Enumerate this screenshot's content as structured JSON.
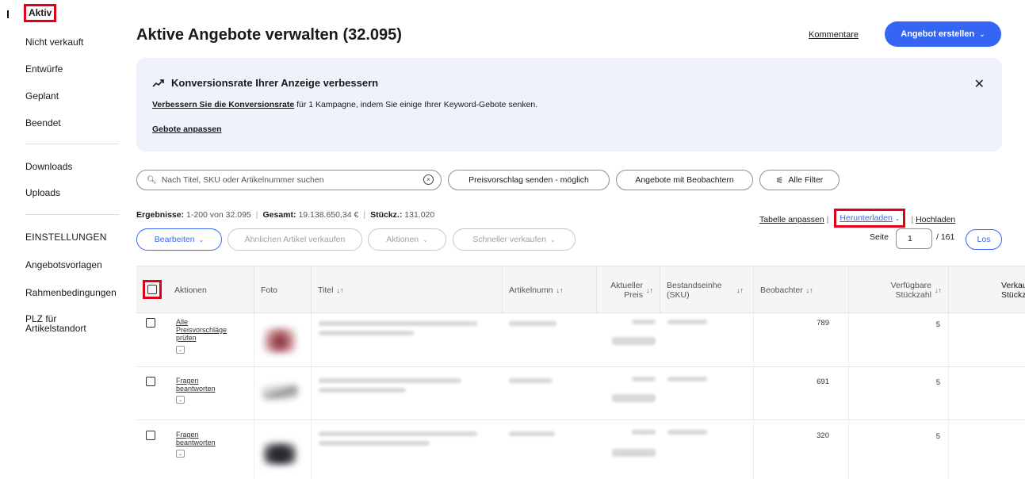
{
  "sidebar": {
    "items": [
      {
        "label": "Aktiv"
      },
      {
        "label": "Nicht verkauft"
      },
      {
        "label": "Entwürfe"
      },
      {
        "label": "Geplant"
      },
      {
        "label": "Beendet"
      },
      {
        "label": "Downloads"
      },
      {
        "label": "Uploads"
      }
    ],
    "settings_heading": "EINSTELLUNGEN",
    "settings_items": [
      {
        "label": "Angebotsvorlagen"
      },
      {
        "label": "Rahmenbedingungen"
      },
      {
        "label": "PLZ für"
      },
      {
        "label": "Artikelstandort"
      }
    ]
  },
  "header": {
    "title": "Aktive Angebote verwalten (32.095)",
    "comments_link": "Kommentare",
    "create_button": "Angebot erstellen"
  },
  "banner": {
    "title": "Konversionsrate Ihrer Anzeige verbessern",
    "text_link": "Verbessern Sie die Konversionsrate",
    "text_rest": " für 1 Kampagne, indem Sie einige Ihrer Keyword-Gebote senken.",
    "action_link": "Gebote anpassen",
    "close": "✕"
  },
  "search": {
    "placeholder": "Nach Titel, SKU oder Artikelnummer suchen"
  },
  "filters": {
    "offer": "Preisvorschlag senden - möglich",
    "watchers": "Angebote mit Beobachtern",
    "all": "Alle Filter"
  },
  "results": {
    "label": "Ergebnisse:",
    "range": "1-200 von 32.095",
    "total_label": "Gesamt:",
    "total": "19.138.650,34 €",
    "pieces_label": "Stückz.:",
    "pieces": "131.020"
  },
  "links": {
    "customize": "Tabelle anpassen",
    "download": "Herunterladen",
    "upload": "Hochladen"
  },
  "actions": {
    "edit": "Bearbeiten",
    "sell_similar": "Ähnlichen Artikel verkaufen",
    "actions": "Aktionen",
    "quick_sell": "Schneller verkaufen"
  },
  "pagination": {
    "label": "Seite",
    "current": "1",
    "total": "/ 161",
    "go": "Los"
  },
  "table": {
    "headers": {
      "actions": "Aktionen",
      "photo": "Foto",
      "title": "Titel",
      "item_number": "Artikelnumn",
      "price_1": "Aktueller",
      "price_2": "Preis",
      "sku_1": "Bestandseinhe",
      "sku_2": "(SKU)",
      "watchers": "Beobachter",
      "available_1": "Verfügbare",
      "available_2": "Stückzahl",
      "sold_1": "Verkau",
      "sold_2": "Stückz"
    },
    "rows": [
      {
        "action_1": "Alle",
        "action_2": "Preisvorschläge",
        "action_3": "prüfen",
        "watchers": "789",
        "available": "5"
      },
      {
        "action_1": "Fragen",
        "action_2": "beantworten",
        "action_3": "",
        "watchers": "691",
        "available": "5"
      },
      {
        "action_1": "Fragen",
        "action_2": "beantworten",
        "action_3": "",
        "watchers": "320",
        "available": "5"
      }
    ]
  }
}
